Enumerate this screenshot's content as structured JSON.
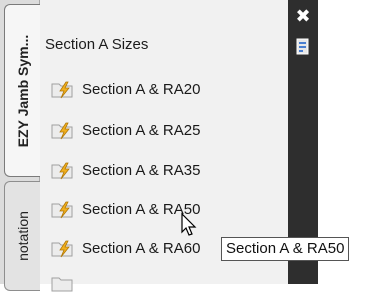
{
  "palette": {
    "tabs": [
      {
        "label": "EZY Jamb Sym...",
        "active": true
      },
      {
        "label": "notation",
        "active": false
      }
    ],
    "section_title": "Section A Sizes",
    "tools": [
      {
        "label": "Section A & RA20",
        "icon": "lightning-bolt-icon"
      },
      {
        "label": "Section A & RA25",
        "icon": "lightning-bolt-icon"
      },
      {
        "label": "Section A & RA35",
        "icon": "lightning-bolt-icon"
      },
      {
        "label": "Section A & RA50",
        "icon": "lightning-bolt-icon"
      },
      {
        "label": "Section A & RA60",
        "icon": "lightning-bolt-icon"
      }
    ],
    "titlebar": {
      "close_label": "✖"
    },
    "tooltip": "Section A & RA50"
  },
  "colors": {
    "titlebar": "#2e2e2e",
    "bolt": "#f2b01e",
    "background": "#f1f1f1"
  }
}
